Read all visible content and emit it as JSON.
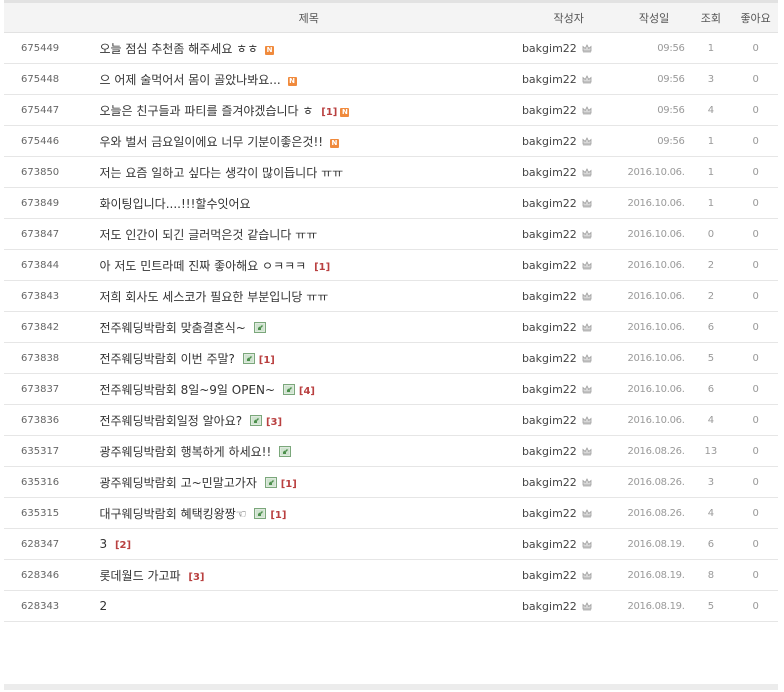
{
  "header": {
    "number": "",
    "title": "제목",
    "writer": "작성자",
    "date": "작성일",
    "views": "조회",
    "likes": "좋아요"
  },
  "posts": [
    {
      "num": "675449",
      "title": "오늘 점심 추천좀 해주세요 ㅎㅎ",
      "reply": "",
      "new": true,
      "image": false,
      "writer": "bakgim22",
      "date": "09:56",
      "views": "1",
      "likes": "0"
    },
    {
      "num": "675448",
      "title": "으 어제 술먹어서 몸이 골았나봐요...",
      "reply": "",
      "new": true,
      "image": false,
      "writer": "bakgim22",
      "date": "09:56",
      "views": "3",
      "likes": "0"
    },
    {
      "num": "675447",
      "title": "오늘은 친구들과 파티를 즐겨야겠습니다 ㅎ",
      "reply": "[1]",
      "new": true,
      "image": false,
      "writer": "bakgim22",
      "date": "09:56",
      "views": "4",
      "likes": "0"
    },
    {
      "num": "675446",
      "title": "우와 벌서 금요일이에요 너무 기분이좋은것!!",
      "reply": "",
      "new": true,
      "image": false,
      "writer": "bakgim22",
      "date": "09:56",
      "views": "1",
      "likes": "0"
    },
    {
      "num": "673850",
      "title": "저는 요즘 일하고 싶다는 생각이 많이듭니다 ㅠㅠ",
      "reply": "",
      "new": false,
      "image": false,
      "writer": "bakgim22",
      "date": "2016.10.06.",
      "views": "1",
      "likes": "0"
    },
    {
      "num": "673849",
      "title": "화이팅입니다....!!!할수잇어요",
      "reply": "",
      "new": false,
      "image": false,
      "writer": "bakgim22",
      "date": "2016.10.06.",
      "views": "1",
      "likes": "0"
    },
    {
      "num": "673847",
      "title": "저도 인간이 되긴 글러먹은것 같습니다 ㅠㅠ",
      "reply": "",
      "new": false,
      "image": false,
      "writer": "bakgim22",
      "date": "2016.10.06.",
      "views": "0",
      "likes": "0"
    },
    {
      "num": "673844",
      "title": "아 저도 민트라떼 진짜 좋아해요 ㅇㅋㅋㅋ",
      "reply": "[1]",
      "new": false,
      "image": false,
      "writer": "bakgim22",
      "date": "2016.10.06.",
      "views": "2",
      "likes": "0"
    },
    {
      "num": "673843",
      "title": "저희 회사도 세스코가 필요한 부분입니당 ㅠㅠ",
      "reply": "",
      "new": false,
      "image": false,
      "writer": "bakgim22",
      "date": "2016.10.06.",
      "views": "2",
      "likes": "0"
    },
    {
      "num": "673842",
      "title": "전주웨딩박람회 맞춤결혼식~",
      "reply": "",
      "new": false,
      "image": true,
      "writer": "bakgim22",
      "date": "2016.10.06.",
      "views": "6",
      "likes": "0"
    },
    {
      "num": "673838",
      "title": "전주웨딩박람회 이번 주말?",
      "reply": "[1]",
      "new": false,
      "image": true,
      "writer": "bakgim22",
      "date": "2016.10.06.",
      "views": "5",
      "likes": "0"
    },
    {
      "num": "673837",
      "title": "전주웨딩박람회 8일~9일 OPEN~",
      "reply": "[4]",
      "new": false,
      "image": true,
      "writer": "bakgim22",
      "date": "2016.10.06.",
      "views": "6",
      "likes": "0"
    },
    {
      "num": "673836",
      "title": "전주웨딩박람회일정 알아요?",
      "reply": "[3]",
      "new": false,
      "image": true,
      "writer": "bakgim22",
      "date": "2016.10.06.",
      "views": "4",
      "likes": "0"
    },
    {
      "num": "635317",
      "title": "광주웨딩박람회 행복하게 하세요!!",
      "reply": "",
      "new": false,
      "image": true,
      "writer": "bakgim22",
      "date": "2016.08.26.",
      "views": "13",
      "likes": "0"
    },
    {
      "num": "635316",
      "title": "광주웨딩박람회 고~민말고가자",
      "reply": "[1]",
      "new": false,
      "image": true,
      "writer": "bakgim22",
      "date": "2016.08.26.",
      "views": "3",
      "likes": "0"
    },
    {
      "num": "635315",
      "title": "대구웨딩박람회 혜택킹왕짱☜",
      "reply": "[1]",
      "new": false,
      "image": true,
      "writer": "bakgim22",
      "date": "2016.08.26.",
      "views": "4",
      "likes": "0"
    },
    {
      "num": "628347",
      "title": "3",
      "reply": "[2]",
      "new": false,
      "image": false,
      "writer": "bakgim22",
      "date": "2016.08.19.",
      "views": "6",
      "likes": "0"
    },
    {
      "num": "628346",
      "title": "롯데월드 가고파",
      "reply": "[3]",
      "new": false,
      "image": false,
      "writer": "bakgim22",
      "date": "2016.08.19.",
      "views": "8",
      "likes": "0"
    },
    {
      "num": "628343",
      "title": "2",
      "reply": "",
      "new": false,
      "image": false,
      "writer": "bakgim22",
      "date": "2016.08.19.",
      "views": "5",
      "likes": "0"
    }
  ],
  "icons": {
    "new": "new-badge-icon",
    "image": "image-attachment-icon",
    "writer_level": "crown-icon"
  },
  "colors": {
    "new_badge": "#f08a3c",
    "reply_count": "#b94040",
    "date_text": "#9a9a9a"
  }
}
